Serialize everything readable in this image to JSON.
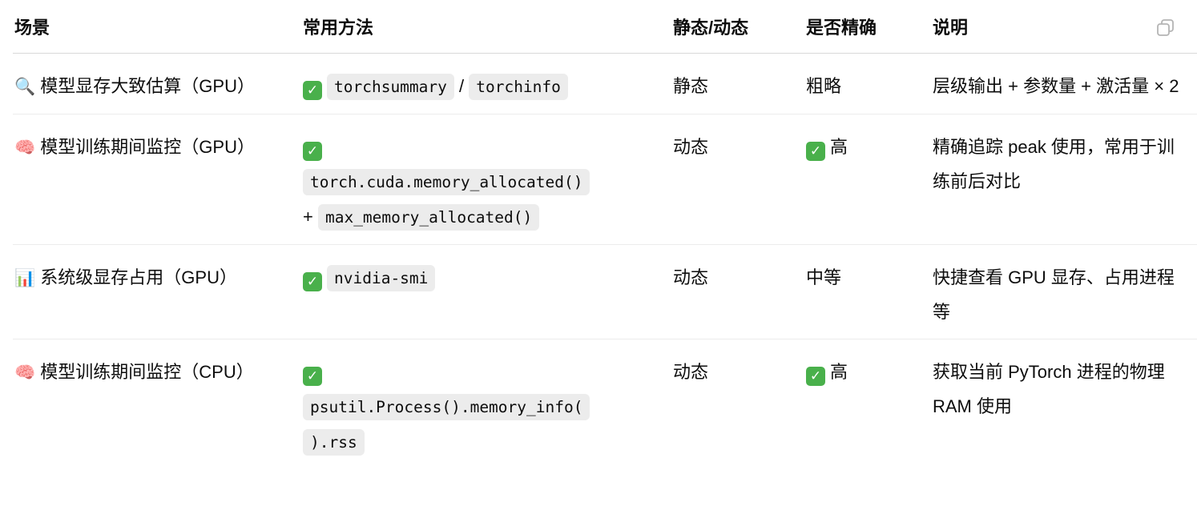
{
  "table": {
    "headers": [
      "场景",
      "常用方法",
      "静态/动态",
      "是否精确",
      "说明"
    ],
    "rows": [
      {
        "scene_icon": "🔍",
        "scene_icon_name": "magnifier-icon",
        "scene": "模型显存大致估算（GPU）",
        "method_prefix_check": true,
        "method_parts": [
          {
            "type": "code",
            "text": "torchsummary"
          },
          {
            "type": "text",
            "text": " / "
          },
          {
            "type": "code",
            "text": "torchinfo"
          }
        ],
        "static_dynamic": "静态",
        "precise_check": false,
        "precise": "粗略",
        "desc": "层级输出 + 参数量 + 激活量 × 2"
      },
      {
        "scene_icon": "🧠",
        "scene_icon_name": "brain-icon",
        "scene": "模型训练期间监控（GPU）",
        "method_prefix_check": true,
        "method_parts": [
          {
            "type": "br"
          },
          {
            "type": "code",
            "text": "torch.cuda.memory_allocated()"
          },
          {
            "type": "br"
          },
          {
            "type": "text",
            "text": "+ "
          },
          {
            "type": "code",
            "text": "max_memory_allocated()"
          }
        ],
        "static_dynamic": "动态",
        "precise_check": true,
        "precise": "高",
        "desc": "精确追踪 peak 使用，常用于训练前后对比"
      },
      {
        "scene_icon": "📊",
        "scene_icon_name": "bar-chart-icon",
        "scene": "系统级显存占用（GPU）",
        "method_prefix_check": true,
        "method_parts": [
          {
            "type": "code",
            "text": "nvidia-smi"
          }
        ],
        "static_dynamic": "动态",
        "precise_check": false,
        "precise": "中等",
        "desc": "快捷查看 GPU 显存、占用进程等"
      },
      {
        "scene_icon": "🧠",
        "scene_icon_name": "brain-icon",
        "scene": "模型训练期间监控（CPU）",
        "method_prefix_check": true,
        "method_parts": [
          {
            "type": "br"
          },
          {
            "type": "code",
            "text": "psutil.Process().memory_info("
          },
          {
            "type": "br"
          },
          {
            "type": "code",
            "text": ").rss"
          }
        ],
        "static_dynamic": "动态",
        "precise_check": true,
        "precise": "高",
        "desc": "获取当前 PyTorch 进程的物理 RAM 使用"
      }
    ]
  },
  "icons": {
    "check": "✓",
    "check_color": "#49b04b",
    "copy": "copy-icon"
  }
}
